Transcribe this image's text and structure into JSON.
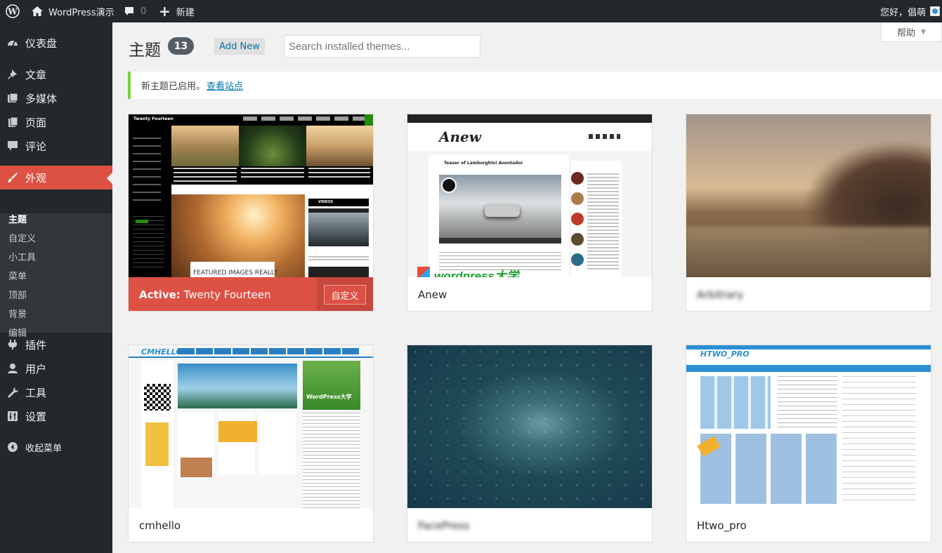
{
  "adminbar": {
    "site_name": "WordPress演示",
    "comments_count": "0",
    "new_label": "新建",
    "greeting": "您好，倡萌"
  },
  "sidebar": {
    "dashboard": "仪表盘",
    "posts": "文章",
    "media": "多媒体",
    "pages": "页面",
    "comments": "评论",
    "appearance": "外观",
    "sub": [
      "主题",
      "自定义",
      "小工具",
      "菜单",
      "顶部",
      "背景",
      "编辑"
    ],
    "plugins": "插件",
    "users": "用户",
    "tools": "工具",
    "settings": "设置",
    "collapse": "收起菜单"
  },
  "page": {
    "title": "主题",
    "count": "13",
    "add_new": "Add New",
    "search_placeholder": "Search installed themes...",
    "help": "帮助"
  },
  "notice": {
    "text": "新主题已启用。",
    "link": "查看站点"
  },
  "themes": [
    {
      "name": "Twenty Fourteen",
      "active_prefix": "Active:",
      "customize": "自定义"
    },
    {
      "name": "Anew"
    },
    {
      "name": "Arbitrary"
    },
    {
      "name": "cmhello"
    },
    {
      "name": "FacePress"
    },
    {
      "name": "Htwo_pro"
    }
  ],
  "shots": {
    "tf_site": "Twenty Fourteen",
    "tf_featured": "FEATURED IMAGES REALLY",
    "tf_videos": "VIDEOS",
    "anew_logo": "Anew",
    "anew_post": "Teaser of Lamborghini Aventador",
    "watermark": "wordpress大学",
    "cm_logo": "CMHELLO",
    "cm_side": "WordPress大学",
    "ht_logo": "HTWO_PRO"
  },
  "colors": {
    "accent": "#dd5145",
    "sidebar": "#23282d",
    "link": "#0073aa",
    "notice": "#7ad03a"
  }
}
